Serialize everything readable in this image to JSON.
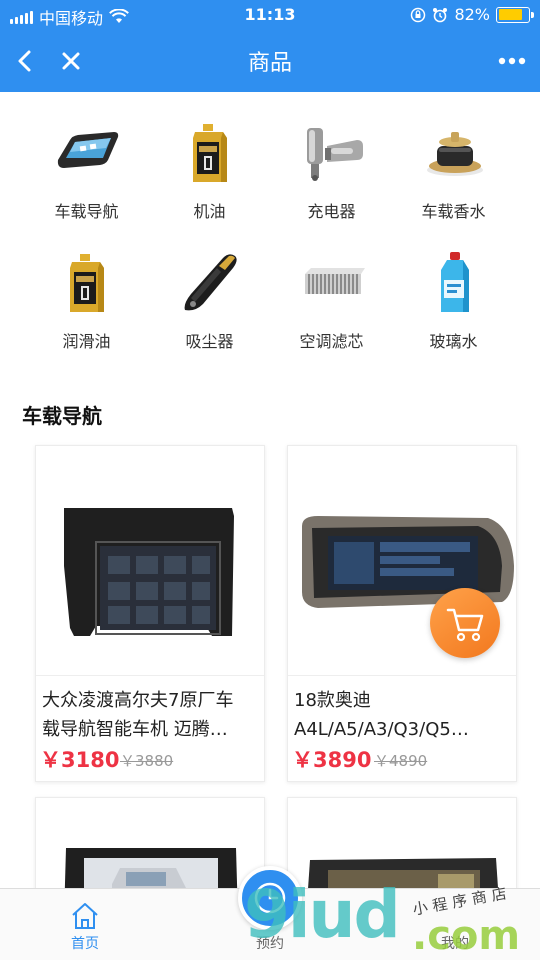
{
  "status_bar": {
    "carrier": "中国移动",
    "time": "11:13",
    "battery_percent": "82%",
    "battery_level": 0.82,
    "battery_color": "#ffcc00"
  },
  "nav": {
    "title": "商品",
    "icons": [
      "back-icon",
      "close-icon",
      "more-icon"
    ]
  },
  "theme": {
    "primary": "#2f8ff0",
    "price_red": "#ee3344",
    "cart_orange": "#f7862e"
  },
  "categories": [
    {
      "label": "车载导航",
      "icon": "car-navigation-icon"
    },
    {
      "label": "机油",
      "icon": "engine-oil-icon"
    },
    {
      "label": "充电器",
      "icon": "car-charger-icon"
    },
    {
      "label": "车载香水",
      "icon": "car-perfume-icon"
    },
    {
      "label": "润滑油",
      "icon": "lubricant-icon"
    },
    {
      "label": "吸尘器",
      "icon": "vacuum-icon"
    },
    {
      "label": "空调滤芯",
      "icon": "ac-filter-icon"
    },
    {
      "label": "玻璃水",
      "icon": "washer-fluid-icon"
    }
  ],
  "section": {
    "title": "车载导航",
    "products": [
      {
        "name_line1": "大众凌渡高尔夫7原厂车",
        "name_line2": "载导航智能车机 迈腾…",
        "price": "￥3180",
        "original_price": "￥3880"
      },
      {
        "name_line1": "18款奥迪",
        "name_line2": "A4L/A5/A3/Q3/Q5…",
        "price": "￥3890",
        "original_price": "￥4890"
      }
    ]
  },
  "tab_bar": {
    "items": [
      {
        "label": "首页",
        "icon": "home-icon",
        "active": true
      },
      {
        "label": "预约",
        "icon": "clock-icon",
        "active": false
      },
      {
        "label": "我的",
        "icon": "user-icon",
        "active": false
      }
    ],
    "active_color": "#2f8ff0"
  },
  "watermark": {
    "main": "9iud",
    "suffix": ".com",
    "tag": "小程序商店"
  }
}
